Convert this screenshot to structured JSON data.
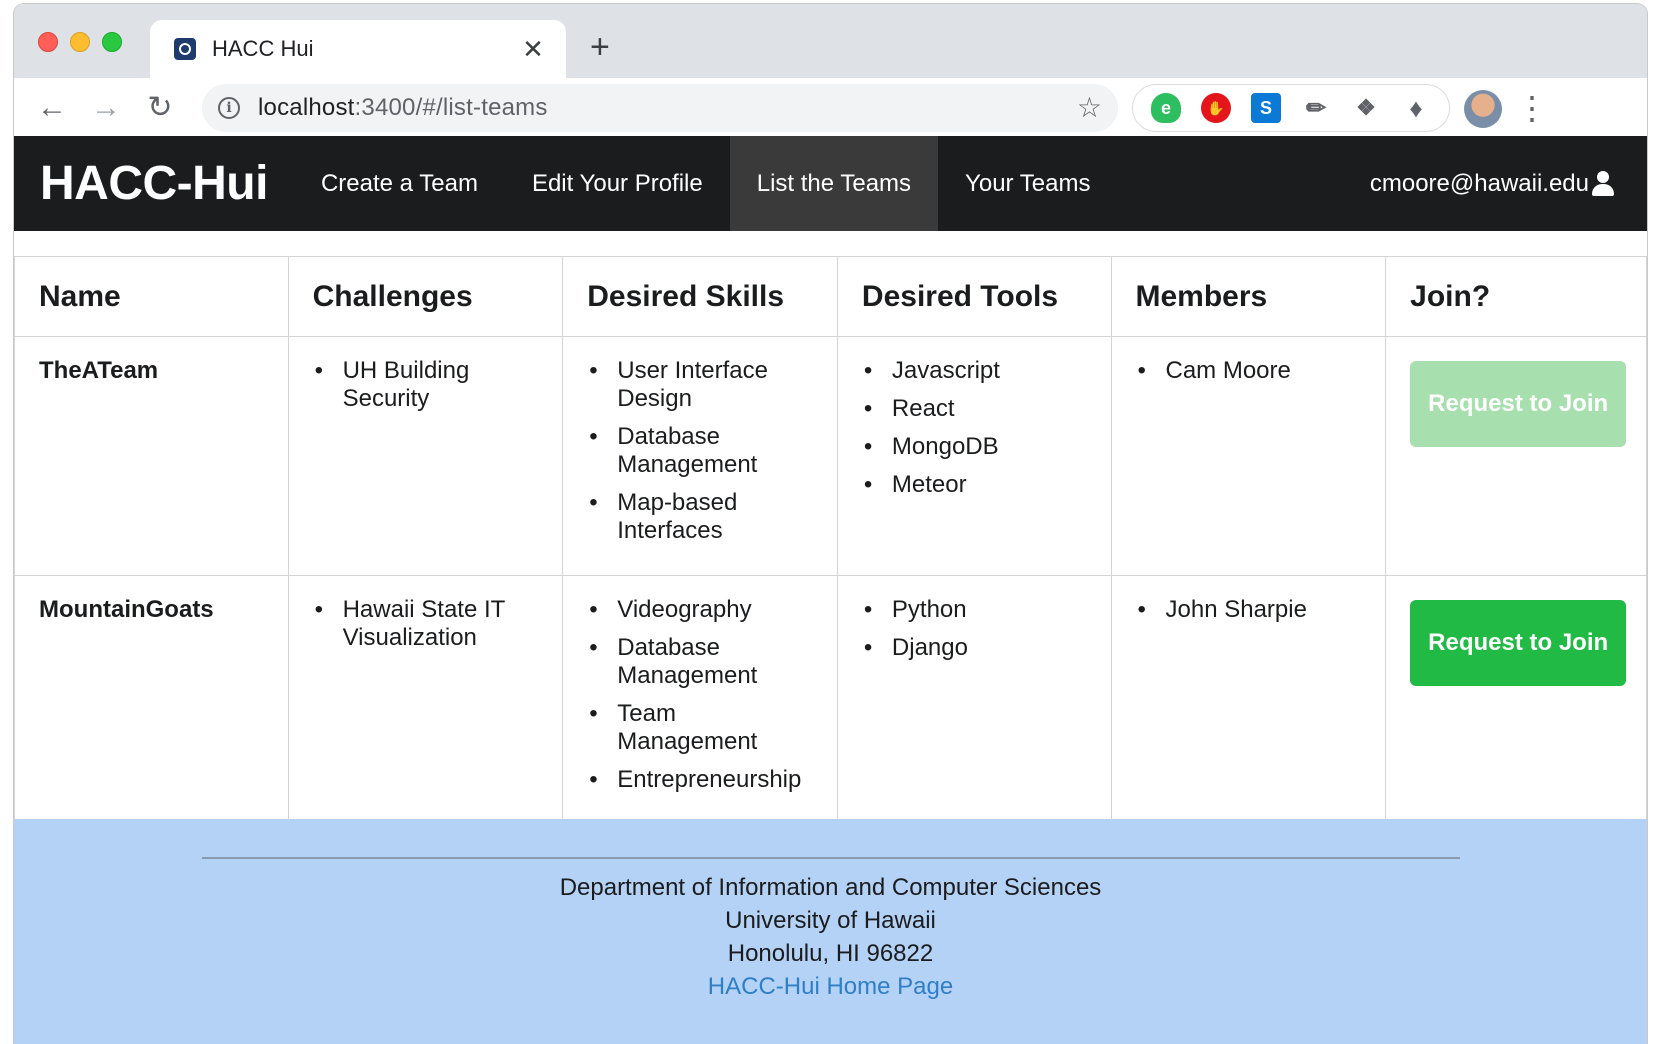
{
  "browser": {
    "tab_title": "HACC Hui",
    "tab_close": "✕",
    "new_tab": "+",
    "url_host": "localhost",
    "url_rest": ":3400/#/list-teams",
    "icons": [
      "back-arrow-icon",
      "forward-arrow-icon",
      "reload-icon",
      "info-icon",
      "star-icon",
      "evernote-icon",
      "adblock-icon",
      "skype-icon",
      "eyedropper-icon",
      "dropbox-icon",
      "extensions-puzzle-icon",
      "profile-avatar",
      "kebab-menu-icon"
    ]
  },
  "navbar": {
    "brand": "HACC-Hui",
    "items": [
      "Create a Team",
      "Edit Your Profile",
      "List the Teams",
      "Your Teams"
    ],
    "active_item": "List the Teams",
    "user_email": "cmoore@hawaii.edu"
  },
  "table": {
    "headers": [
      "Name",
      "Challenges",
      "Desired Skills",
      "Desired Tools",
      "Members",
      "Join?"
    ],
    "rows": [
      {
        "name": "TheATeam",
        "challenges": [
          "UH Building Security"
        ],
        "skills": [
          "User Interface Design",
          "Database Management",
          "Map-based Interfaces"
        ],
        "tools": [
          "Javascript",
          "React",
          "MongoDB",
          "Meteor"
        ],
        "members": [
          "Cam Moore"
        ],
        "button": "Request to Join",
        "button_enabled": false
      },
      {
        "name": "MountainGoats",
        "challenges": [
          "Hawaii State IT Visualization"
        ],
        "skills": [
          "Videography",
          "Database Management",
          "Team Management",
          "Entrepreneurship"
        ],
        "tools": [
          "Python",
          "Django"
        ],
        "members": [
          "John Sharpie"
        ],
        "button": "Request to Join",
        "button_enabled": true
      }
    ]
  },
  "footer": {
    "line1": "Department of Information and Computer Sciences",
    "line2": "University of Hawaii",
    "line3": "Honolulu, HI 96822",
    "link": "HACC-Hui Home Page"
  },
  "colors": {
    "navbar_bg": "#1b1c1d",
    "button_green": "#21ba45",
    "button_disabled": "#a8dfae",
    "footer_bg": "#b4d1f6",
    "link": "#2f7fc6"
  }
}
